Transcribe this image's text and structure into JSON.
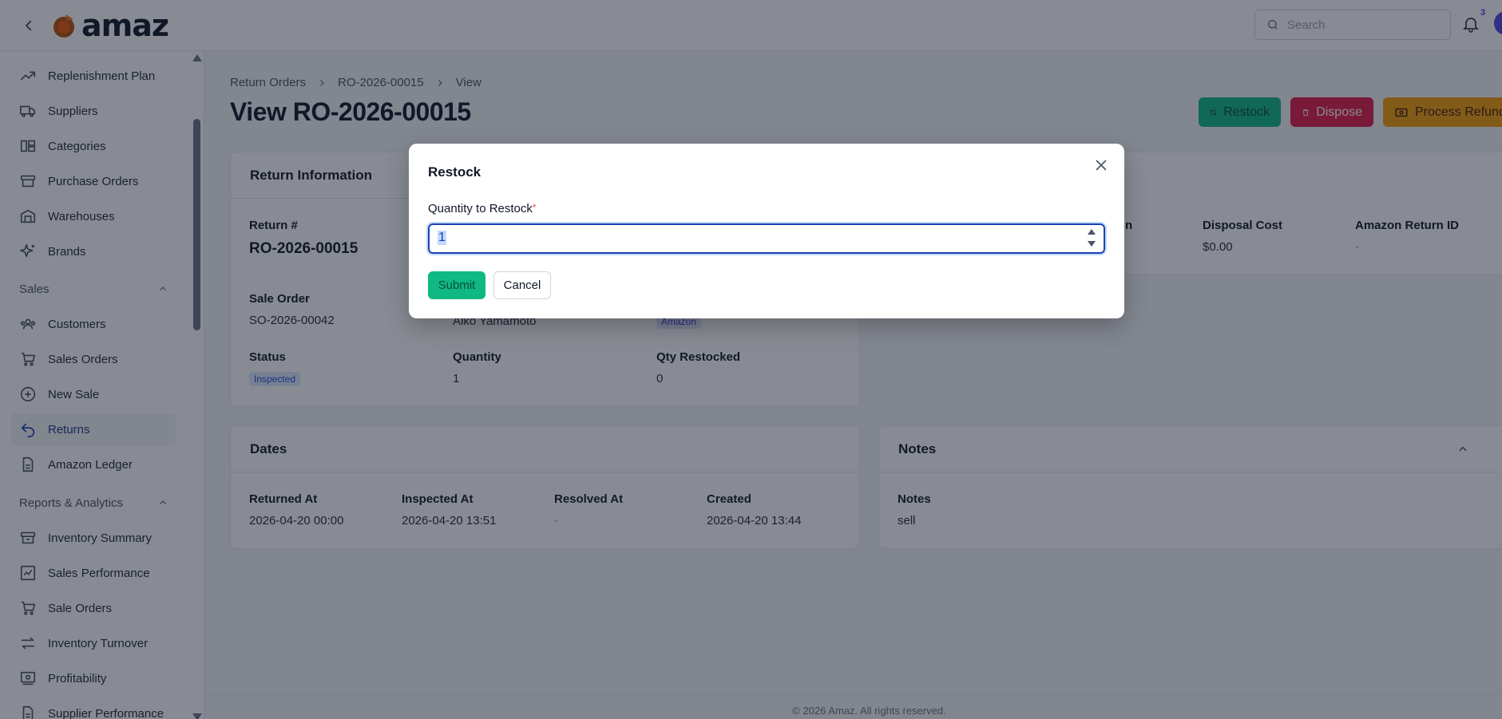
{
  "app": {
    "logo_text": "amaz"
  },
  "search": {
    "placeholder": "Search"
  },
  "notifications": {
    "count": "3"
  },
  "sidebar": {
    "items_top": [
      {
        "label": "Replenishment Plan",
        "icon": "trend-up-icon"
      },
      {
        "label": "Suppliers",
        "icon": "truck-icon"
      },
      {
        "label": "Categories",
        "icon": "grid-icon"
      },
      {
        "label": "Purchase Orders",
        "icon": "archive-icon"
      },
      {
        "label": "Warehouses",
        "icon": "warehouse-icon"
      },
      {
        "label": "Brands",
        "icon": "sparkles-icon"
      }
    ],
    "section_sales": "Sales",
    "items_sales": [
      {
        "label": "Customers",
        "icon": "users-icon"
      },
      {
        "label": "Sales Orders",
        "icon": "cart-icon"
      },
      {
        "label": "New Sale",
        "icon": "plus-circle-icon"
      },
      {
        "label": "Returns",
        "icon": "return-arrow-icon"
      },
      {
        "label": "Amazon Ledger",
        "icon": "document-icon"
      }
    ],
    "section_reports": "Reports & Analytics",
    "items_reports": [
      {
        "label": "Inventory Summary",
        "icon": "archive-icon"
      },
      {
        "label": "Sales Performance",
        "icon": "chart-icon"
      },
      {
        "label": "Sale Orders",
        "icon": "cart-icon"
      },
      {
        "label": "Inventory Turnover",
        "icon": "arrows-icon"
      },
      {
        "label": "Profitability",
        "icon": "banknote-icon"
      },
      {
        "label": "Supplier Performance",
        "icon": "document-icon"
      }
    ]
  },
  "breadcrumb": [
    "Return Orders",
    "RO-2026-00015",
    "View"
  ],
  "page": {
    "title": "View RO-2026-00015"
  },
  "actions": {
    "restock": "Restock",
    "dispose": "Dispose",
    "refund": "Process Refund"
  },
  "return_info": {
    "heading": "Return Information",
    "return_no_label": "Return #",
    "return_no": "RO-2026-00015",
    "sale_order_label": "Sale Order",
    "sale_order": "SO-2026-00042",
    "customer": "Aiko Yamamoto",
    "channel": "Amazon",
    "status_label": "Status",
    "status": "Inspected",
    "quantity_label": "Quantity",
    "quantity": "1",
    "qty_restocked_label": "Qty Restocked",
    "qty_restocked": "0"
  },
  "costs": {
    "partial_label": "n",
    "disposal_cost_label": "Disposal Cost",
    "disposal_cost": "$0.00",
    "amazon_return_id_label": "Amazon Return ID",
    "amazon_return_id": "-"
  },
  "dates": {
    "heading": "Dates",
    "returned_at_label": "Returned At",
    "returned_at": "2026-04-20 00:00",
    "inspected_at_label": "Inspected At",
    "inspected_at": "2026-04-20 13:51",
    "resolved_at_label": "Resolved At",
    "resolved_at": "-",
    "created_label": "Created",
    "created": "2026-04-20 13:44"
  },
  "notes": {
    "heading": "Notes",
    "label": "Notes",
    "value": "sell"
  },
  "footer": {
    "text": "© 2026 Amaz. All rights reserved."
  },
  "modal": {
    "title": "Restock",
    "field_label": "Quantity to Restock",
    "required_mark": "*",
    "quantity_value": "1",
    "submit": "Submit",
    "cancel": "Cancel"
  },
  "colors": {
    "primary": "#10b981",
    "danger": "#e11d48",
    "warning": "#f59e0b",
    "accent": "#4f46e5"
  }
}
